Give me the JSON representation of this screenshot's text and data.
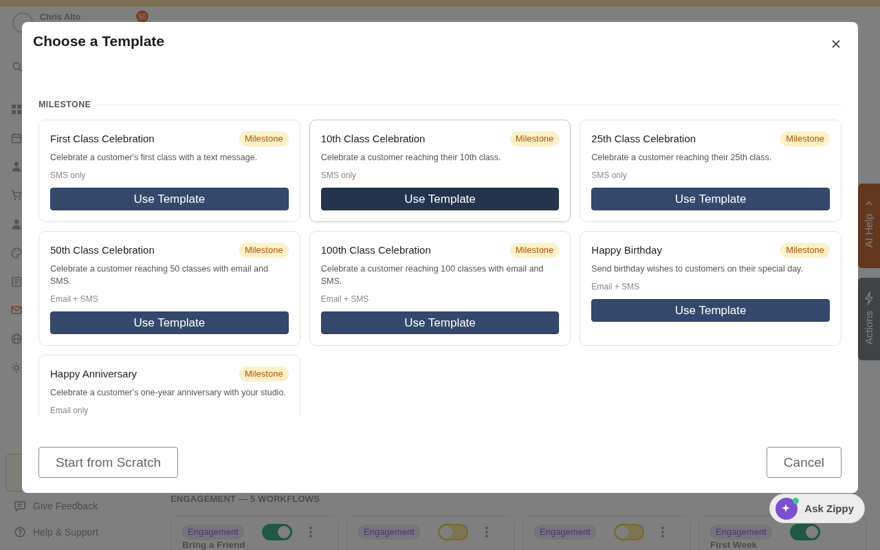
{
  "sidebar": {
    "user_name": "Chris Alto",
    "notification_count": "50",
    "nav_items": [
      {
        "selected": false
      },
      {
        "selected": false
      },
      {
        "selected": false
      },
      {
        "selected": false
      },
      {
        "selected": false
      },
      {
        "selected": false
      },
      {
        "selected": false
      },
      {
        "selected": true
      },
      {
        "selected": false
      },
      {
        "selected": false
      }
    ],
    "footer_links": [
      "Give Feedback",
      "Help & Support"
    ]
  },
  "main": {
    "section_label": "ENGAGEMENT — 5 WORKFLOWS",
    "workflows": [
      {
        "category": "Engagement",
        "on": true,
        "title": "Bring a Friend"
      },
      {
        "category": "Engagement",
        "on": false
      },
      {
        "category": "Engagement",
        "on": false
      },
      {
        "category": "Engagement",
        "on": true,
        "title": "First Week"
      }
    ]
  },
  "help_tab": {
    "label": "AI Help"
  },
  "actions_tab": {
    "label": "Actions"
  },
  "dialog": {
    "title": "Choose a Template",
    "section_label": "MILESTONE",
    "templates": [
      {
        "title": "First Class Celebration",
        "category": "Milestone",
        "description": "Celebrate a customer's first class with a text message.",
        "channels": "SMS only",
        "button": "Use Template",
        "hovered": false
      },
      {
        "title": "10th Class Celebration",
        "category": "Milestone",
        "description": "Celebrate a customer reaching their 10th class.",
        "channels": "SMS only",
        "button": "Use Template",
        "hovered": true
      },
      {
        "title": "25th Class Celebration",
        "category": "Milestone",
        "description": "Celebrate a customer reaching their 25th class.",
        "channels": "SMS only",
        "button": "Use Template",
        "hovered": false
      },
      {
        "title": "50th Class Celebration",
        "category": "Milestone",
        "description": "Celebrate a customer reaching 50 classes with email and SMS.",
        "channels": "Email + SMS",
        "button": "Use Template",
        "hovered": false
      },
      {
        "title": "100th Class Celebration",
        "category": "Milestone",
        "description": "Celebrate a customer reaching 100 classes with email and SMS.",
        "channels": "Email + SMS",
        "button": "Use Template",
        "hovered": false
      },
      {
        "title": "Happy Birthday",
        "category": "Milestone",
        "description": "Send birthday wishes to customers on their special day.",
        "channels": "Email + SMS",
        "button": "Use Template",
        "hovered": false
      },
      {
        "title": "Happy Anniversary",
        "category": "Milestone",
        "description": "Celebrate a customer's one-year anniversary with your studio.",
        "channels": "Email only",
        "hovered": false
      }
    ],
    "scratch_button": "Start from Scratch",
    "cancel_button": "Cancel"
  },
  "assistant_button": {
    "label": "Ask Zippy"
  }
}
